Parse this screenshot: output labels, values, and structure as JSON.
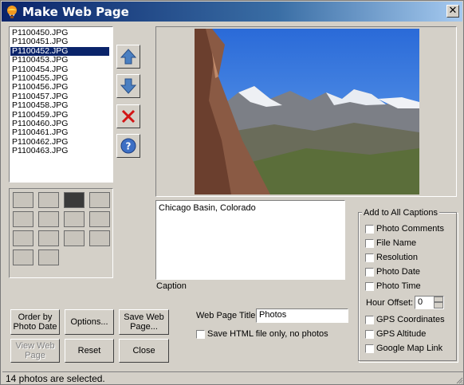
{
  "window": {
    "title": "Make Web Page",
    "close_label": "✕"
  },
  "files": [
    "P1100450.JPG",
    "P1100451.JPG",
    "P1100452.JPG",
    "P1100453.JPG",
    "P1100454.JPG",
    "P1100455.JPG",
    "P1100456.JPG",
    "P1100457.JPG",
    "P1100458.JPG",
    "P1100459.JPG",
    "P1100460.JPG",
    "P1100461.JPG",
    "P1100462.JPG",
    "P1100463.JPG"
  ],
  "selected_file": "P1100452.JPG",
  "side_buttons": [
    "up-arrow-icon",
    "down-arrow-icon",
    "delete-x-icon",
    "help-icon"
  ],
  "thumbs_selected_index": 2,
  "caption": {
    "text": "Chicago Basin, Colorado",
    "label": "Caption"
  },
  "add_to_all": {
    "title": "Add to All Captions",
    "items": [
      "Photo Comments",
      "File Name",
      "Resolution",
      "Photo Date",
      "Photo Time"
    ],
    "hour_offset_label": "Hour Offset:",
    "hour_offset_value": "0",
    "items2": [
      "GPS Coordinates",
      "GPS Altitude",
      "Google Map Link"
    ]
  },
  "buttons": {
    "order": "Order by Photo Date",
    "options": "Options...",
    "save": "Save Web Page...",
    "view": "View Web Page",
    "reset": "Reset",
    "close": "Close"
  },
  "web_title_label": "Web Page Title:",
  "web_title_value": "Photos",
  "save_html_label": "Save HTML file only, no photos",
  "status": "14 photos are selected."
}
